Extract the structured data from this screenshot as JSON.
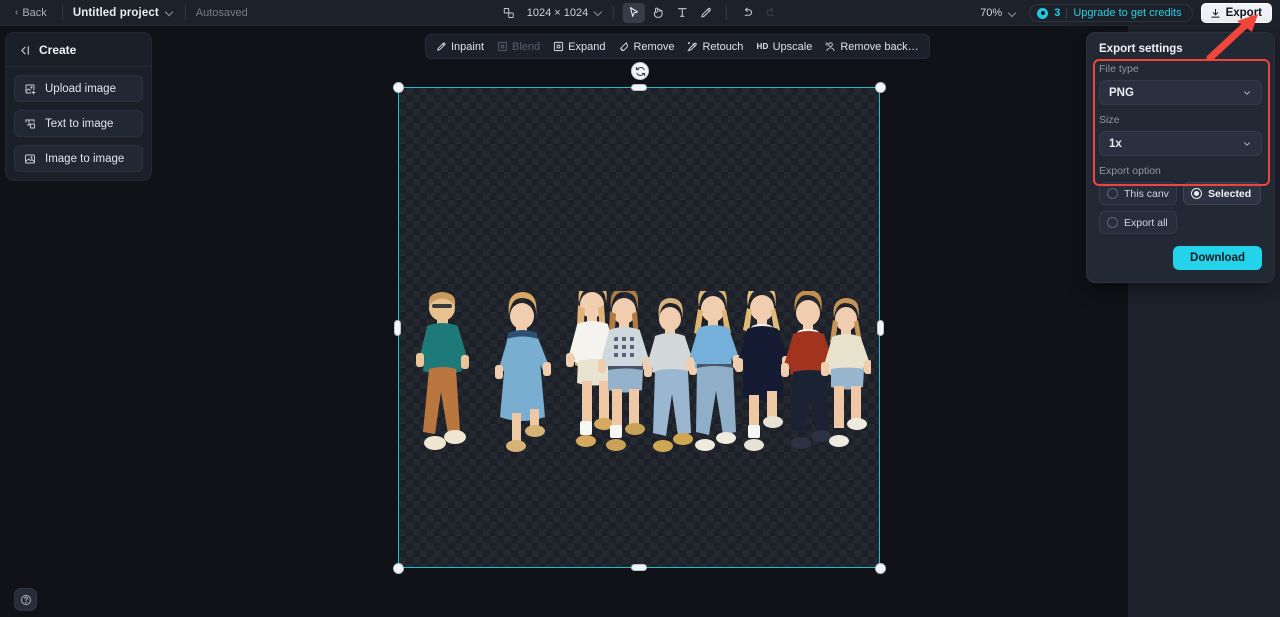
{
  "topbar": {
    "back_label": "Back",
    "project_name": "Untitled project",
    "autosave_status": "Autosaved",
    "canvas_dimensions": "1024 × 1024",
    "zoom_level": "70%",
    "credits_count": "3",
    "upgrade_label": "Upgrade to get credits",
    "export_label": "Export",
    "tools": [
      {
        "name": "frame-icon",
        "label": "Frame"
      },
      {
        "name": "select-tool-icon",
        "label": "Select",
        "active": true
      },
      {
        "name": "hand-tool-icon",
        "label": "Hand"
      },
      {
        "name": "text-tool-icon",
        "label": "Text"
      },
      {
        "name": "brush-tool-icon",
        "label": "Brush"
      },
      {
        "name": "undo-icon",
        "label": "Undo"
      },
      {
        "name": "redo-icon",
        "label": "Redo",
        "disabled": true
      }
    ]
  },
  "sidebar": {
    "header_label": "Create",
    "items": [
      {
        "label": "Upload image",
        "icon": "upload-image-icon"
      },
      {
        "label": "Text to image",
        "icon": "text-to-image-icon"
      },
      {
        "label": "Image to image",
        "icon": "image-to-image-icon"
      }
    ]
  },
  "edit_toolbar": {
    "items": [
      {
        "label": "Inpaint",
        "icon": "inpaint-icon",
        "disabled": false
      },
      {
        "label": "Blend",
        "icon": "blend-icon",
        "disabled": true
      },
      {
        "label": "Expand",
        "icon": "expand-icon",
        "disabled": false
      },
      {
        "label": "Remove",
        "icon": "remove-icon",
        "disabled": false
      },
      {
        "label": "Retouch",
        "icon": "retouch-icon",
        "disabled": false
      },
      {
        "label": "Upscale",
        "icon": "upscale-hd-icon",
        "disabled": false
      },
      {
        "label": "Remove back…",
        "icon": "remove-background-icon",
        "disabled": false
      }
    ]
  },
  "export_panel": {
    "title": "Export settings",
    "file_type_label": "File type",
    "file_type_value": "PNG",
    "size_label": "Size",
    "size_value": "1x",
    "export_option_label": "Export option",
    "options": [
      {
        "label": "This canvas",
        "selected": false
      },
      {
        "label": "Selected l…",
        "selected": true
      },
      {
        "label": "Export all …",
        "selected": false
      }
    ],
    "download_label": "Download"
  },
  "canvas": {
    "selection_colour": "#1fbfcf",
    "accent_colour": "#22d3ea",
    "annotation_colour": "#f0453a",
    "image_description": "Ten children running side by side on a transparent background"
  },
  "help": {
    "label": "Help",
    "icon": "help-circle-icon"
  }
}
